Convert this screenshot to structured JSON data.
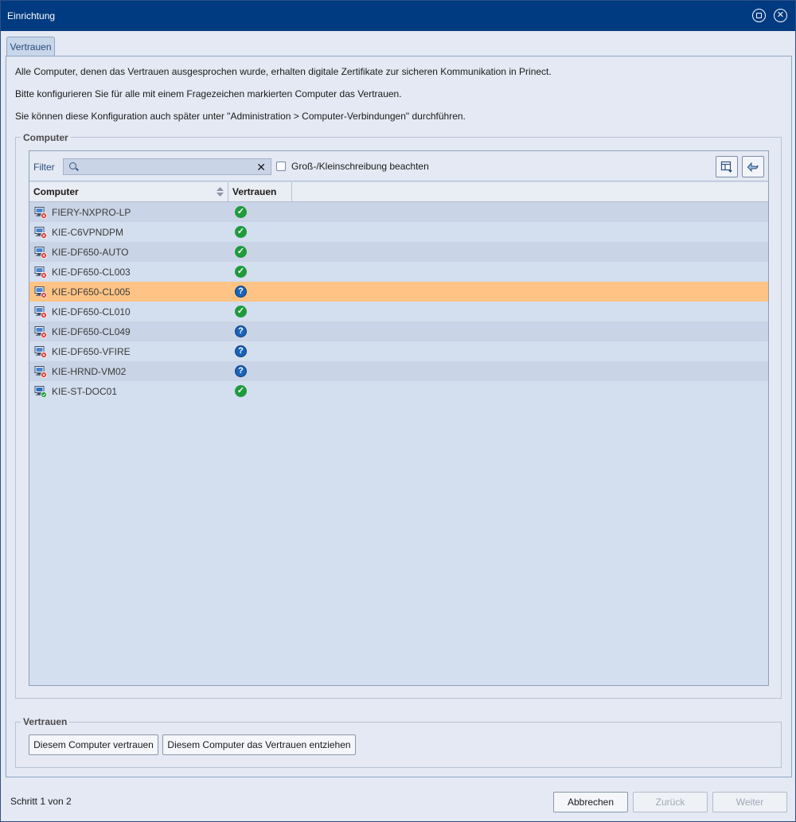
{
  "window": {
    "title": "Einrichtung"
  },
  "tabs": [
    {
      "label": "Vertrauen",
      "active": true
    }
  ],
  "info_lines": [
    "Alle Computer, denen das Vertrauen ausgesprochen wurde, erhalten digitale Zertifikate zur sicheren Kommunikation in Prinect.",
    "Bitte konfigurieren Sie für alle mit einem Fragezeichen markierten Computer das Vertrauen.",
    "Sie können diese Konfiguration auch später unter \"Administration > Computer-Verbindungen\" durchführen."
  ],
  "computer_group": {
    "legend": "Computer",
    "filter": {
      "label": "Filter",
      "value": "",
      "placeholder": ""
    },
    "case_sensitive": {
      "label": "Groß-/Kleinschreibung beachten",
      "checked": false
    },
    "columns": [
      "Computer",
      "Vertrauen"
    ],
    "rows": [
      {
        "name": "FIERY-NXPRO-LP",
        "trust": "trusted",
        "icon": "computer-disconnected-icon"
      },
      {
        "name": "KIE-C6VPNDPM",
        "trust": "trusted",
        "icon": "computer-disconnected-icon"
      },
      {
        "name": "KIE-DF650-AUTO",
        "trust": "trusted",
        "icon": "computer-disconnected-icon"
      },
      {
        "name": "KIE-DF650-CL003",
        "trust": "trusted",
        "icon": "computer-disconnected-icon"
      },
      {
        "name": "KIE-DF650-CL005",
        "trust": "unknown",
        "icon": "computer-disconnected-icon",
        "selected": true
      },
      {
        "name": "KIE-DF650-CL010",
        "trust": "trusted",
        "icon": "computer-disconnected-icon"
      },
      {
        "name": "KIE-DF650-CL049",
        "trust": "unknown",
        "icon": "computer-disconnected-icon"
      },
      {
        "name": "KIE-DF650-VFIRE",
        "trust": "unknown",
        "icon": "computer-disconnected-icon"
      },
      {
        "name": "KIE-HRND-VM02",
        "trust": "unknown",
        "icon": "computer-disconnected-icon"
      },
      {
        "name": "KIE-ST-DOC01",
        "trust": "trusted",
        "icon": "computer-connected-icon"
      }
    ]
  },
  "trust_group": {
    "legend": "Vertrauen",
    "trust_button": "Diesem Computer vertrauen",
    "revoke_button": "Diesem Computer das Vertrauen entziehen"
  },
  "footer": {
    "status": "Schritt 1 von 2",
    "cancel": "Abbrechen",
    "back": "Zurück",
    "next": "Weiter"
  },
  "colors": {
    "titlebar": "#003a80",
    "selected_row": "#ffc485",
    "trusted": "#1f9a3c",
    "unknown": "#1a63b8"
  }
}
